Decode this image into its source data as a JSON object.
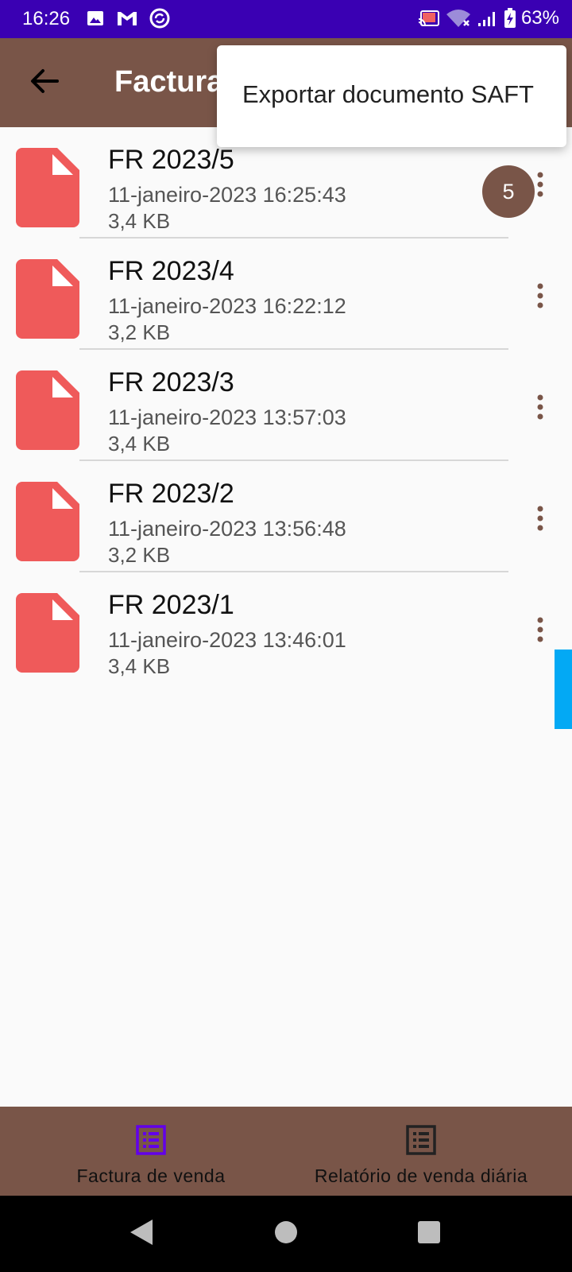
{
  "status_bar": {
    "time": "16:26",
    "battery": "63%",
    "icons_left": [
      "image-icon",
      "gmail-icon",
      "sync-icon"
    ],
    "icons_right": [
      "cast-icon",
      "wifi-icon",
      "signal-icon",
      "battery-charging-icon"
    ]
  },
  "app_bar": {
    "title": "Factura"
  },
  "popup_menu": {
    "items": [
      "Exportar documento SAFT"
    ]
  },
  "files": [
    {
      "name": "FR 2023/5",
      "date": "11-janeiro-2023 16:25:43",
      "size": "3,4 KB"
    },
    {
      "name": "FR 2023/4",
      "date": "11-janeiro-2023 16:22:12",
      "size": "3,2 KB"
    },
    {
      "name": "FR 2023/3",
      "date": "11-janeiro-2023 13:57:03",
      "size": "3,4 KB"
    },
    {
      "name": "FR 2023/2",
      "date": "11-janeiro-2023 13:56:48",
      "size": "3,2 KB"
    },
    {
      "name": "FR 2023/1",
      "date": "11-janeiro-2023 13:46:01",
      "size": "3,4 KB"
    }
  ],
  "badge": {
    "count": "5"
  },
  "bottom_nav": {
    "items": [
      {
        "label": "Factura de venda",
        "active": true
      },
      {
        "label": "Relatório de venda diária",
        "active": false
      }
    ]
  },
  "colors": {
    "status_bar": "#3a00b3",
    "app_bar": "#795548",
    "file_icon": "#ef5a5a",
    "active_nav_icon": "#6200ea",
    "scroll_tab": "#03a9f4"
  }
}
